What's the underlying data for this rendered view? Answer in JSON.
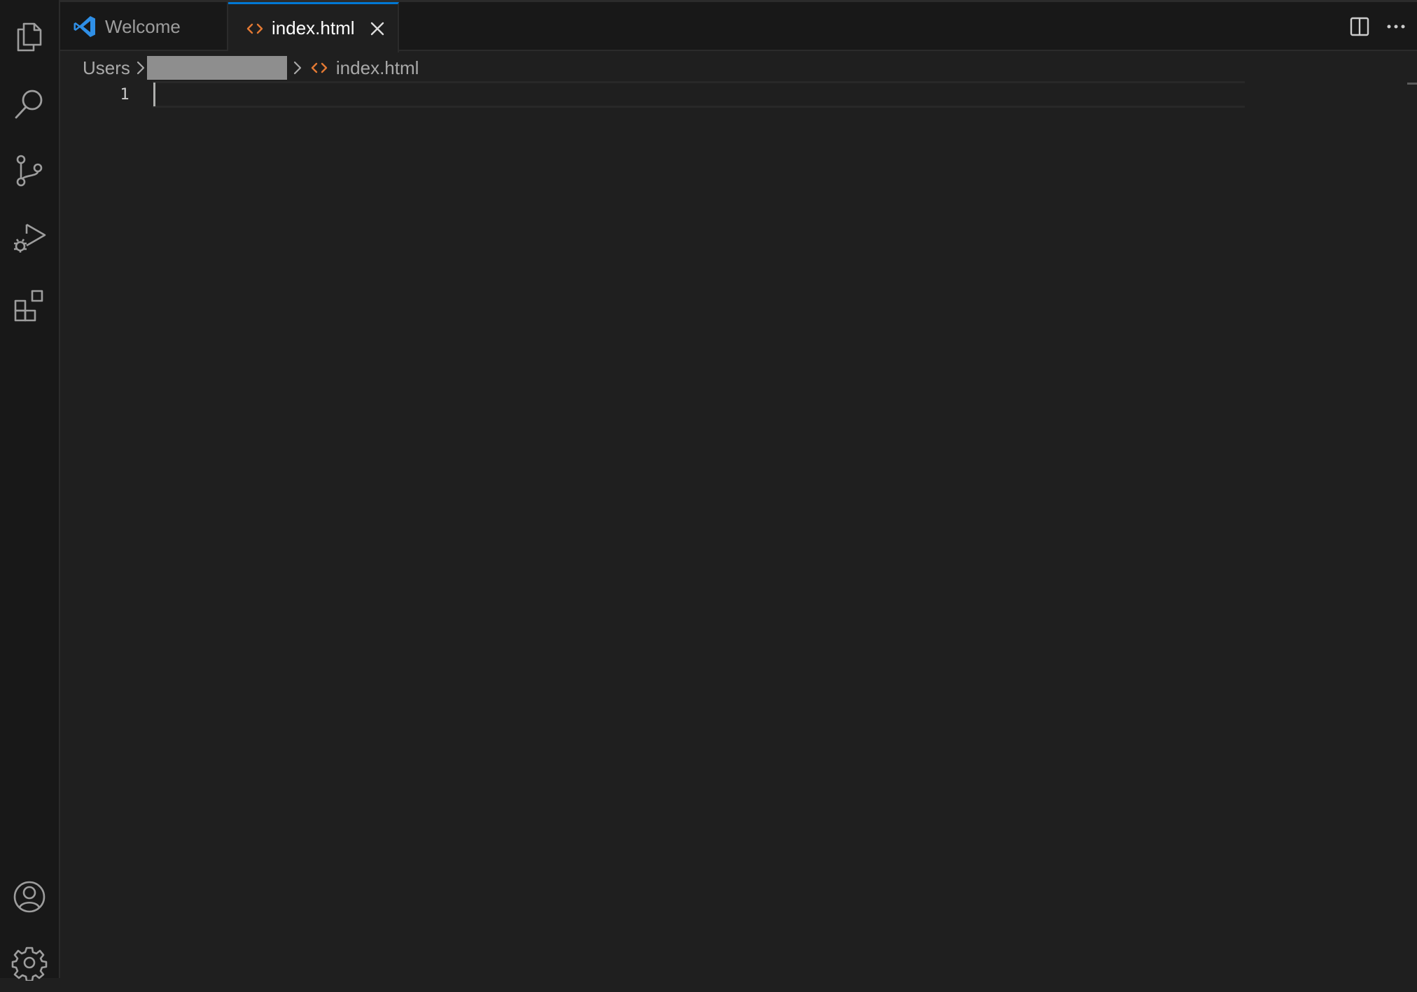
{
  "tabs": [
    {
      "label": "Welcome",
      "icon": "vscode-logo-icon",
      "active": false
    },
    {
      "label": "index.html",
      "icon": "html-file-icon",
      "active": true
    }
  ],
  "tab_actions": [
    "split-editor-icon",
    "more-actions-icon"
  ],
  "activity_bar": {
    "items": [
      "explorer-icon",
      "search-icon",
      "source-control-icon",
      "run-debug-icon",
      "extensions-icon"
    ],
    "bottom": [
      "accounts-icon",
      "settings-gear-icon"
    ]
  },
  "breadcrumb": {
    "root": "Users",
    "file": "index.html"
  },
  "editor": {
    "lines": [
      {
        "number": "1",
        "text": ""
      }
    ]
  },
  "colors": {
    "accent": "#0078d4",
    "html_icon": "#e37933",
    "vscode_logo": "#2f8fe6",
    "editor_bg": "#1f1f1f",
    "sidebar_bg": "#181818"
  }
}
